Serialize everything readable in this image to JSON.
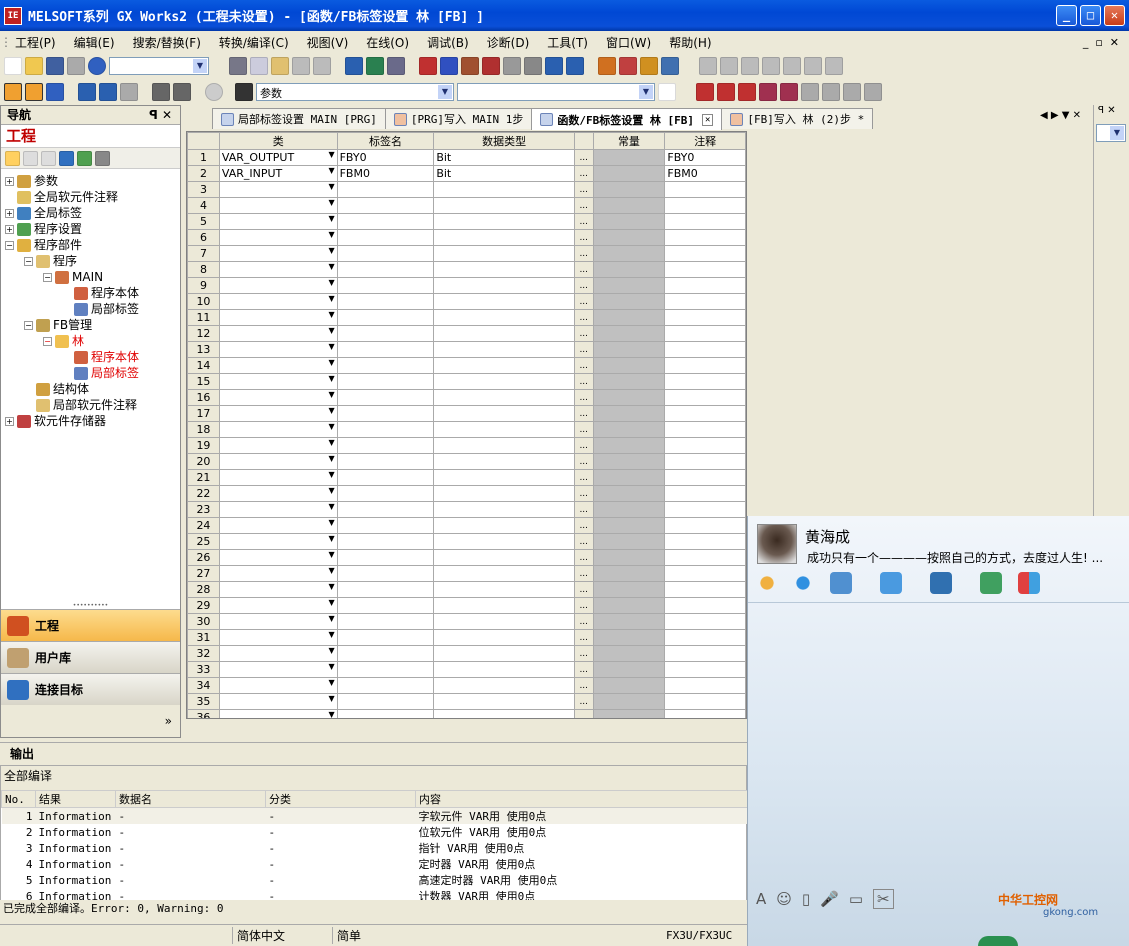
{
  "window": {
    "title": "MELSOFT系列 GX Works2 (工程未设置) - [函数/FB标签设置 林 [FB] ]"
  },
  "menu": [
    "工程(P)",
    "编辑(E)",
    "搜索/替换(F)",
    "转换/编译(C)",
    "视图(V)",
    "在线(O)",
    "调试(B)",
    "诊断(D)",
    "工具(T)",
    "窗口(W)",
    "帮助(H)"
  ],
  "toolbar": {
    "combo2": "参数"
  },
  "nav": {
    "header": "导航",
    "project": "工程",
    "tree": [
      {
        "label": "参数",
        "lvl": 0,
        "pm": "+"
      },
      {
        "label": "全局软元件注释",
        "lvl": 0,
        "pm": ""
      },
      {
        "label": "全局标签",
        "lvl": 0,
        "pm": "+"
      },
      {
        "label": "程序设置",
        "lvl": 0,
        "pm": "+"
      },
      {
        "label": "程序部件",
        "lvl": 0,
        "pm": "-"
      },
      {
        "label": "程序",
        "lvl": 1,
        "pm": "-"
      },
      {
        "label": "MAIN",
        "lvl": 2,
        "pm": "-"
      },
      {
        "label": "程序本体",
        "lvl": 3,
        "pm": ""
      },
      {
        "label": "局部标签",
        "lvl": 3,
        "pm": ""
      },
      {
        "label": "FB管理",
        "lvl": 1,
        "pm": "-"
      },
      {
        "label": "林",
        "lvl": 2,
        "pm": "-",
        "red": true
      },
      {
        "label": "程序本体",
        "lvl": 3,
        "pm": "",
        "red": true
      },
      {
        "label": "局部标签",
        "lvl": 3,
        "pm": "",
        "red": true
      },
      {
        "label": "结构体",
        "lvl": 1,
        "pm": ""
      },
      {
        "label": "局部软元件注释",
        "lvl": 1,
        "pm": ""
      },
      {
        "label": "软元件存储器",
        "lvl": 0,
        "pm": "+"
      }
    ],
    "buttons": [
      "工程",
      "用户库",
      "连接目标"
    ]
  },
  "tabs": [
    "局部标签设置 MAIN [PRG]",
    "[PRG]写入 MAIN 1步",
    "函数/FB标签设置 林 [FB]",
    "[FB]写入 林 (2)步 *"
  ],
  "grid": {
    "headers": [
      "类",
      "标签名",
      "数据类型",
      "常量",
      "注释"
    ],
    "rows": [
      {
        "cls": "VAR_OUTPUT",
        "name": "FBY0",
        "type": "Bit",
        "comment": "FBY0"
      },
      {
        "cls": "VAR_INPUT",
        "name": "FBM0",
        "type": "Bit",
        "comment": "FBM0"
      }
    ],
    "row_count": 36
  },
  "output": {
    "header": "输出",
    "title": "全部编译",
    "columns": [
      "No.",
      "结果",
      "数据名",
      "分类",
      "内容"
    ],
    "rows": [
      [
        "1",
        "Information",
        "-",
        "-",
        "字软元件 VAR用 使用0点"
      ],
      [
        "2",
        "Information",
        "-",
        "-",
        "位软元件 VAR用 使用0点"
      ],
      [
        "3",
        "Information",
        "-",
        "-",
        "指针 VAR用 使用0点"
      ],
      [
        "4",
        "Information",
        "-",
        "-",
        "定时器 VAR用 使用0点"
      ],
      [
        "5",
        "Information",
        "-",
        "-",
        "高速定时器 VAR用 使用0点"
      ],
      [
        "6",
        "Information",
        "-",
        "-",
        "计数器 VAR用 使用0点"
      ]
    ],
    "status": "已完成全部编译。Error: 0, Warning: 0"
  },
  "statusbar": {
    "lang": "简体中文",
    "mode": "简单",
    "plc": "FX3U/FX3UC"
  },
  "chat": {
    "name": "黄海成",
    "signature": "成功只有一个————按照自己的方式，去度过人生!  ...",
    "watermark": "中华工控网",
    "watermark_url": "gkong.com"
  }
}
